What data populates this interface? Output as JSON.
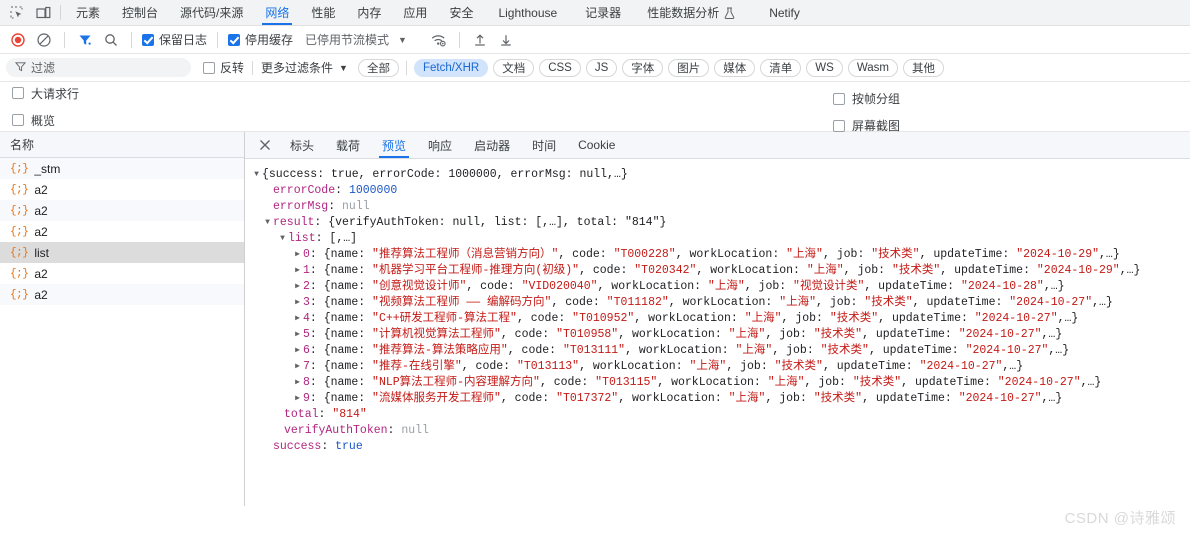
{
  "devtools_tabs": {
    "inspect_icon": "inspect-element-icon",
    "device_icon": "device-toolbar-icon",
    "items": [
      {
        "label": "元素",
        "active": false
      },
      {
        "label": "控制台",
        "active": false
      },
      {
        "label": "源代码/来源",
        "active": false
      },
      {
        "label": "网络",
        "active": true
      },
      {
        "label": "性能",
        "active": false
      },
      {
        "label": "内存",
        "active": false
      },
      {
        "label": "应用",
        "active": false
      },
      {
        "label": "安全",
        "active": false
      },
      {
        "label": "Lighthouse",
        "active": false
      },
      {
        "label": "记录器",
        "active": false
      },
      {
        "label": "性能数据分析",
        "active": false,
        "icon": "flask-icon"
      },
      {
        "label": "Netify",
        "active": false
      }
    ]
  },
  "net_toolbar": {
    "record_icon": "record-button-icon",
    "clear_icon": "clear-network-log-icon",
    "filter_icon": "filter-toggle-icon",
    "search_icon": "search-icon",
    "preserve_log_label": "保留日志",
    "preserve_log_checked": true,
    "disable_cache_label": "停用缓存",
    "disable_cache_checked": true,
    "throttle_label": "已停用节流模式",
    "throttle_caret": "▼",
    "wifi_icon": "network-conditions-icon",
    "import_icon": "import-har-icon",
    "export_icon": "export-har-icon"
  },
  "filter_bar": {
    "filter_icon": "filter-funnel-icon",
    "placeholder": "过滤",
    "value": "",
    "invert_label": "反转",
    "invert_checked": false,
    "more_filters_label": "更多过滤条件",
    "more_filters_caret": "▼",
    "chips": [
      {
        "label": "全部",
        "active": false
      },
      {
        "label": "Fetch/XHR",
        "active": true
      },
      {
        "label": "文档",
        "active": false
      },
      {
        "label": "CSS",
        "active": false
      },
      {
        "label": "JS",
        "active": false
      },
      {
        "label": "字体",
        "active": false
      },
      {
        "label": "图片",
        "active": false
      },
      {
        "label": "媒体",
        "active": false
      },
      {
        "label": "清单",
        "active": false
      },
      {
        "label": "WS",
        "active": false
      },
      {
        "label": "Wasm",
        "active": false
      },
      {
        "label": "其他",
        "active": false
      }
    ]
  },
  "options": {
    "left": [
      {
        "label": "大请求行",
        "checked": false
      },
      {
        "label": "概览",
        "checked": false
      }
    ],
    "right": [
      {
        "label": "按帧分组",
        "checked": false
      },
      {
        "label": "屏幕截图",
        "checked": false
      }
    ]
  },
  "request_pane": {
    "header": "名称",
    "rows": [
      {
        "name": "_stm",
        "icon": "json-file-icon",
        "selected": false
      },
      {
        "name": "a2",
        "icon": "json-file-icon",
        "selected": false
      },
      {
        "name": "a2",
        "icon": "json-file-icon",
        "selected": false
      },
      {
        "name": "a2",
        "icon": "json-file-icon",
        "selected": false
      },
      {
        "name": "list",
        "icon": "json-file-icon",
        "selected": true
      },
      {
        "name": "a2",
        "icon": "json-file-icon",
        "selected": false
      },
      {
        "name": "a2",
        "icon": "json-file-icon",
        "selected": false
      }
    ]
  },
  "detail_pane": {
    "close_icon": "close-icon",
    "tabs": [
      {
        "label": "标头",
        "active": false
      },
      {
        "label": "载荷",
        "active": false
      },
      {
        "label": "预览",
        "active": true
      },
      {
        "label": "响应",
        "active": false
      },
      {
        "label": "启动器",
        "active": false
      },
      {
        "label": "时间",
        "active": false
      },
      {
        "label": "Cookie",
        "active": false
      }
    ]
  },
  "json_preview": {
    "root_summary": "{success: true, errorCode: 1000000, errorMsg: null,…}",
    "errorCode_key": "errorCode",
    "errorCode_value": "1000000",
    "errorMsg_key": "errorMsg",
    "errorMsg_value": "null",
    "result_key": "result",
    "result_summary": "{verifyAuthToken: null, list: [,…], total: \"814\"}",
    "list_key": "list",
    "list_summary": "[,…]",
    "items": [
      {
        "index": "0",
        "name": "推荐算法工程师（消息营销方向）",
        "code": "T000228",
        "workLocation": "上海",
        "job": "技术类",
        "updateTime": "2024-10-29"
      },
      {
        "index": "1",
        "name": "机器学习平台工程师-推理方向(初级)",
        "code": "T020342",
        "workLocation": "上海",
        "job": "技术类",
        "updateTime": "2024-10-29"
      },
      {
        "index": "2",
        "name": "创意视觉设计师",
        "code": "VID020040",
        "workLocation": "上海",
        "job": "视觉设计类",
        "updateTime": "2024-10-28"
      },
      {
        "index": "3",
        "name": "视频算法工程师 —— 编解码方向",
        "code": "T011182",
        "workLocation": "上海",
        "job": "技术类",
        "updateTime": "2024-10-27"
      },
      {
        "index": "4",
        "name": "C++研发工程师-算法工程",
        "code": "T010952",
        "workLocation": "上海",
        "job": "技术类",
        "updateTime": "2024-10-27"
      },
      {
        "index": "5",
        "name": "计算机视觉算法工程师",
        "code": "T010958",
        "workLocation": "上海",
        "job": "技术类",
        "updateTime": "2024-10-27"
      },
      {
        "index": "6",
        "name": "推荐算法-算法策略应用",
        "code": "T013111",
        "workLocation": "上海",
        "job": "技术类",
        "updateTime": "2024-10-27"
      },
      {
        "index": "7",
        "name": "推荐-在线引擎",
        "code": "T013113",
        "workLocation": "上海",
        "job": "技术类",
        "updateTime": "2024-10-27"
      },
      {
        "index": "8",
        "name": "NLP算法工程师-内容理解方向",
        "code": "T013115",
        "workLocation": "上海",
        "job": "技术类",
        "updateTime": "2024-10-27"
      },
      {
        "index": "9",
        "name": "流媒体服务开发工程师",
        "code": "T017372",
        "workLocation": "上海",
        "job": "技术类",
        "updateTime": "2024-10-27"
      }
    ],
    "total_key": "total",
    "total_value": "\"814\"",
    "verifyAuthToken_key": "verifyAuthToken",
    "verifyAuthToken_value": "null",
    "success_key": "success",
    "success_value": "true",
    "triangle_open": "▼",
    "triangle_closed": "▶"
  },
  "watermark": "CSDN @诗雅颂",
  "colors": {
    "accent": "#1a73e8",
    "chip_active_bg": "#d2e3fc",
    "record": "#ea4335",
    "json_icon": "#e8710a",
    "key": "#b0267f",
    "string": "#c41a16",
    "number": "#1a56c4",
    "null": "#9aa0a6"
  }
}
